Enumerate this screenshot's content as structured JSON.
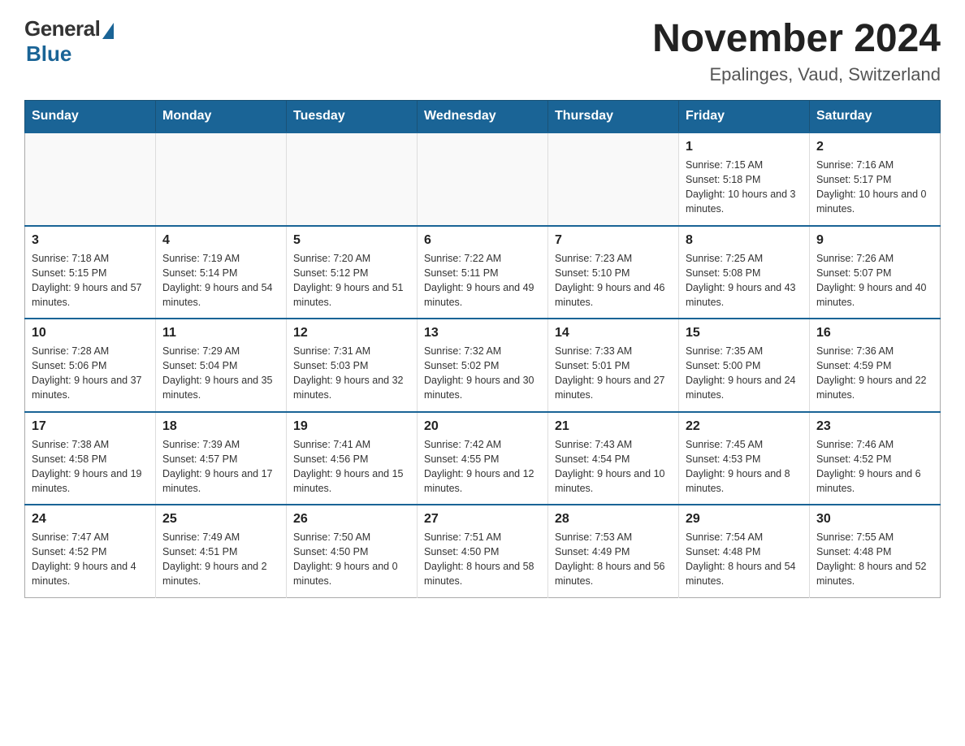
{
  "logo": {
    "general": "General",
    "blue": "Blue"
  },
  "title": "November 2024",
  "location": "Epalinges, Vaud, Switzerland",
  "days_of_week": [
    "Sunday",
    "Monday",
    "Tuesday",
    "Wednesday",
    "Thursday",
    "Friday",
    "Saturday"
  ],
  "weeks": [
    [
      {
        "day": "",
        "info": ""
      },
      {
        "day": "",
        "info": ""
      },
      {
        "day": "",
        "info": ""
      },
      {
        "day": "",
        "info": ""
      },
      {
        "day": "",
        "info": ""
      },
      {
        "day": "1",
        "info": "Sunrise: 7:15 AM\nSunset: 5:18 PM\nDaylight: 10 hours and 3 minutes."
      },
      {
        "day": "2",
        "info": "Sunrise: 7:16 AM\nSunset: 5:17 PM\nDaylight: 10 hours and 0 minutes."
      }
    ],
    [
      {
        "day": "3",
        "info": "Sunrise: 7:18 AM\nSunset: 5:15 PM\nDaylight: 9 hours and 57 minutes."
      },
      {
        "day": "4",
        "info": "Sunrise: 7:19 AM\nSunset: 5:14 PM\nDaylight: 9 hours and 54 minutes."
      },
      {
        "day": "5",
        "info": "Sunrise: 7:20 AM\nSunset: 5:12 PM\nDaylight: 9 hours and 51 minutes."
      },
      {
        "day": "6",
        "info": "Sunrise: 7:22 AM\nSunset: 5:11 PM\nDaylight: 9 hours and 49 minutes."
      },
      {
        "day": "7",
        "info": "Sunrise: 7:23 AM\nSunset: 5:10 PM\nDaylight: 9 hours and 46 minutes."
      },
      {
        "day": "8",
        "info": "Sunrise: 7:25 AM\nSunset: 5:08 PM\nDaylight: 9 hours and 43 minutes."
      },
      {
        "day": "9",
        "info": "Sunrise: 7:26 AM\nSunset: 5:07 PM\nDaylight: 9 hours and 40 minutes."
      }
    ],
    [
      {
        "day": "10",
        "info": "Sunrise: 7:28 AM\nSunset: 5:06 PM\nDaylight: 9 hours and 37 minutes."
      },
      {
        "day": "11",
        "info": "Sunrise: 7:29 AM\nSunset: 5:04 PM\nDaylight: 9 hours and 35 minutes."
      },
      {
        "day": "12",
        "info": "Sunrise: 7:31 AM\nSunset: 5:03 PM\nDaylight: 9 hours and 32 minutes."
      },
      {
        "day": "13",
        "info": "Sunrise: 7:32 AM\nSunset: 5:02 PM\nDaylight: 9 hours and 30 minutes."
      },
      {
        "day": "14",
        "info": "Sunrise: 7:33 AM\nSunset: 5:01 PM\nDaylight: 9 hours and 27 minutes."
      },
      {
        "day": "15",
        "info": "Sunrise: 7:35 AM\nSunset: 5:00 PM\nDaylight: 9 hours and 24 minutes."
      },
      {
        "day": "16",
        "info": "Sunrise: 7:36 AM\nSunset: 4:59 PM\nDaylight: 9 hours and 22 minutes."
      }
    ],
    [
      {
        "day": "17",
        "info": "Sunrise: 7:38 AM\nSunset: 4:58 PM\nDaylight: 9 hours and 19 minutes."
      },
      {
        "day": "18",
        "info": "Sunrise: 7:39 AM\nSunset: 4:57 PM\nDaylight: 9 hours and 17 minutes."
      },
      {
        "day": "19",
        "info": "Sunrise: 7:41 AM\nSunset: 4:56 PM\nDaylight: 9 hours and 15 minutes."
      },
      {
        "day": "20",
        "info": "Sunrise: 7:42 AM\nSunset: 4:55 PM\nDaylight: 9 hours and 12 minutes."
      },
      {
        "day": "21",
        "info": "Sunrise: 7:43 AM\nSunset: 4:54 PM\nDaylight: 9 hours and 10 minutes."
      },
      {
        "day": "22",
        "info": "Sunrise: 7:45 AM\nSunset: 4:53 PM\nDaylight: 9 hours and 8 minutes."
      },
      {
        "day": "23",
        "info": "Sunrise: 7:46 AM\nSunset: 4:52 PM\nDaylight: 9 hours and 6 minutes."
      }
    ],
    [
      {
        "day": "24",
        "info": "Sunrise: 7:47 AM\nSunset: 4:52 PM\nDaylight: 9 hours and 4 minutes."
      },
      {
        "day": "25",
        "info": "Sunrise: 7:49 AM\nSunset: 4:51 PM\nDaylight: 9 hours and 2 minutes."
      },
      {
        "day": "26",
        "info": "Sunrise: 7:50 AM\nSunset: 4:50 PM\nDaylight: 9 hours and 0 minutes."
      },
      {
        "day": "27",
        "info": "Sunrise: 7:51 AM\nSunset: 4:50 PM\nDaylight: 8 hours and 58 minutes."
      },
      {
        "day": "28",
        "info": "Sunrise: 7:53 AM\nSunset: 4:49 PM\nDaylight: 8 hours and 56 minutes."
      },
      {
        "day": "29",
        "info": "Sunrise: 7:54 AM\nSunset: 4:48 PM\nDaylight: 8 hours and 54 minutes."
      },
      {
        "day": "30",
        "info": "Sunrise: 7:55 AM\nSunset: 4:48 PM\nDaylight: 8 hours and 52 minutes."
      }
    ]
  ]
}
